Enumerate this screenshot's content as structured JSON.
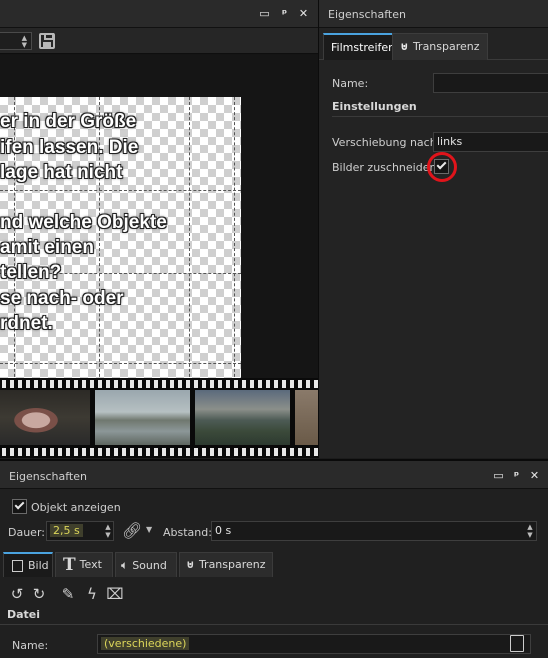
{
  "window_controls": {
    "restore": "▭",
    "pin": "ᵖ",
    "close": "✕"
  },
  "editor": {
    "overlay_lines": [
      "er in der Größe",
      "ifen lassen. Die",
      "lage hat nicht",
      "nd welche Objekte",
      "amit einen",
      "tellen?",
      "se nach- oder",
      "rdnet."
    ],
    "icons": {
      "save": "save-icon",
      "stepper": "spinner-icon"
    }
  },
  "top_properties": {
    "title": "Eigenschaften",
    "tabs": [
      {
        "label": "Filmstreifen",
        "active": true
      },
      {
        "label": "Transparenz",
        "active": false
      }
    ],
    "name_label": "Name:",
    "name_value": "",
    "section_settings": "Einstellungen",
    "shift_label": "Verschiebung nach:",
    "shift_value": "links",
    "crop_label": "Bilder zuschneiden",
    "crop_checked": true,
    "highlight_color": "#e0141b"
  },
  "bottom_properties": {
    "title": "Eigenschaften",
    "show_object_label": "Objekt anzeigen",
    "show_object_checked": true,
    "duration_label": "Dauer:",
    "duration_value": "2,5 s",
    "distance_label": "Abstand:",
    "distance_value": "0 s",
    "tabs": [
      {
        "label": "Bild",
        "icon": "image-icon",
        "active": true
      },
      {
        "label": "Text",
        "icon": "text-icon",
        "active": false
      },
      {
        "label": "Sound",
        "icon": "speaker-icon",
        "active": false
      },
      {
        "label": "Transparenz",
        "icon": "transparency-icon",
        "active": false
      }
    ],
    "section_file": "Datei",
    "name_label": "Name:",
    "name_value": "(verschiedene)",
    "accent_color": "#4aa3df",
    "value_color": "#dcd65a"
  }
}
